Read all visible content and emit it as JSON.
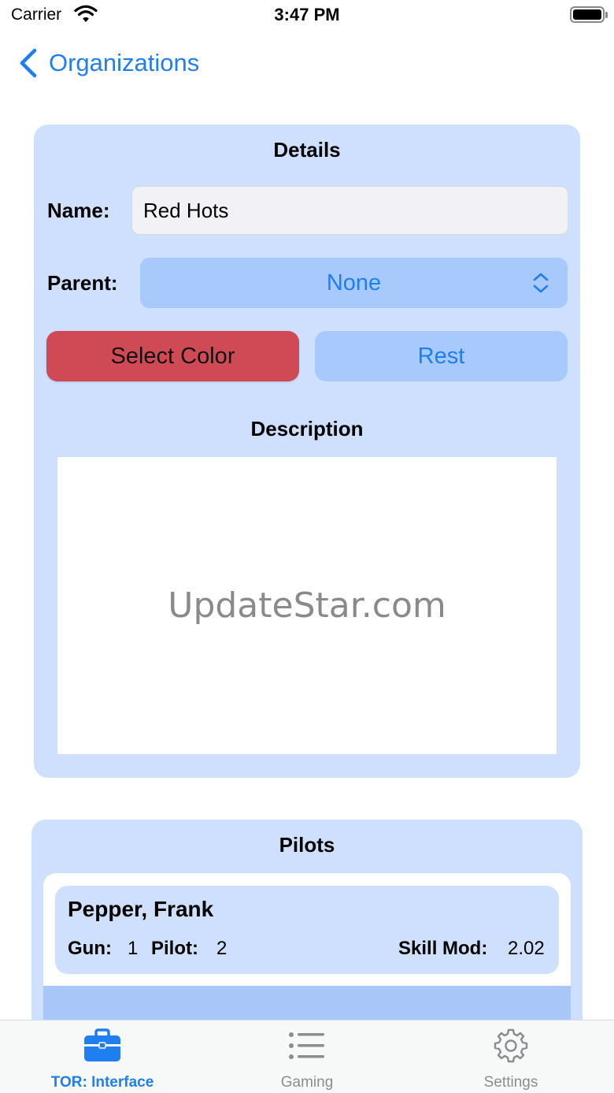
{
  "status_bar": {
    "carrier": "Carrier",
    "time": "3:47 PM"
  },
  "nav": {
    "back_label": "Organizations"
  },
  "details": {
    "title": "Details",
    "name_label": "Name:",
    "name_value": "Red Hots",
    "parent_label": "Parent:",
    "parent_value": "None",
    "select_color_label": "Select Color",
    "rest_label": "Rest",
    "description_title": "Description",
    "description_text": "UpdateStar.com"
  },
  "pilots": {
    "title": "Pilots",
    "items": [
      {
        "name": "Pepper, Frank",
        "gun_label": "Gun:",
        "gun": "1",
        "pilot_label": "Pilot:",
        "pilot": "2",
        "skill_label": "Skill Mod:",
        "skill": "2.02"
      }
    ]
  },
  "tab_bar": {
    "tabs": [
      {
        "label": "TOR: Interface",
        "icon": "briefcase-icon",
        "active": true
      },
      {
        "label": "Gaming",
        "icon": "list-icon",
        "active": false
      },
      {
        "label": "Settings",
        "icon": "gear-icon",
        "active": false
      }
    ]
  },
  "colors": {
    "accent": "#1f7ef0",
    "card": "#cfe0ff",
    "button_light": "#a7c9fb",
    "select_color_button": "#d04a56"
  }
}
